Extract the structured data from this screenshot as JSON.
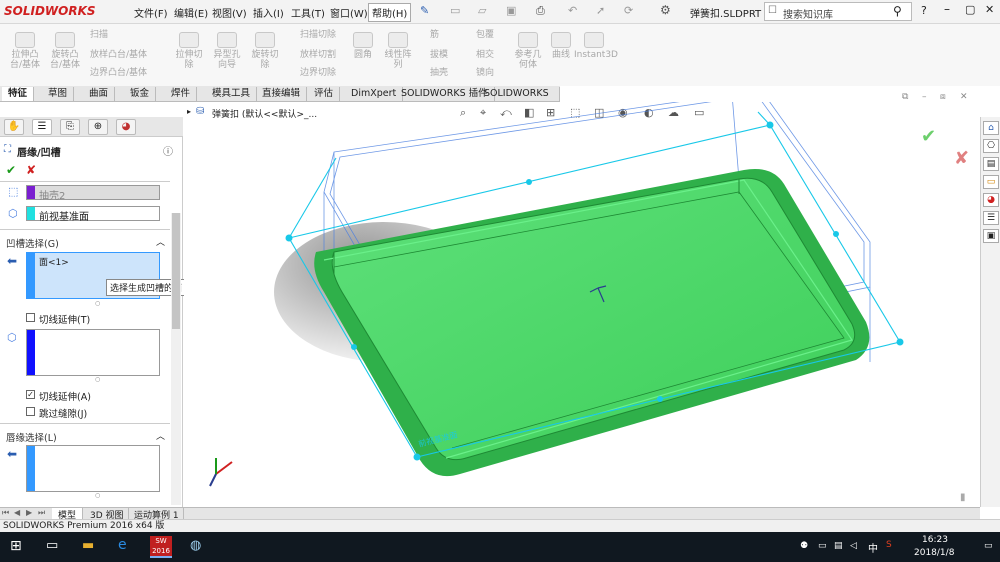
{
  "titlebar": {
    "logo": "SOLIDWORKS",
    "menus": [
      "文件(F)",
      "编辑(E)",
      "视图(V)",
      "插入(I)",
      "工具(T)",
      "窗口(W)",
      "帮助(H)"
    ],
    "document": "弹簧扣.SLDPRT *",
    "search_placeholder": "搜索知识库"
  },
  "ribbon": {
    "items": [
      {
        "label": "拉伸凸\n台/基体"
      },
      {
        "label": "旋转凸\n台/基体"
      },
      {
        "label": "扫描"
      },
      {
        "label": "放样凸台/基体"
      },
      {
        "label": "边界凸台/基体"
      },
      {
        "label": "拉伸切\n除"
      },
      {
        "label": "异型孔\n向导"
      },
      {
        "label": "旋转切\n除"
      },
      {
        "label": "扫描切除"
      },
      {
        "label": "放样切割"
      },
      {
        "label": "边界切除"
      },
      {
        "label": "圆角"
      },
      {
        "label": "线性阵\n列"
      },
      {
        "label": "筋"
      },
      {
        "label": "拔模"
      },
      {
        "label": "抽壳"
      },
      {
        "label": "包覆"
      },
      {
        "label": "相交"
      },
      {
        "label": "镜向"
      },
      {
        "label": "参考几\n何体"
      },
      {
        "label": "曲线"
      },
      {
        "label": "Instant3D"
      }
    ]
  },
  "command_tabs": [
    "特征",
    "草图",
    "曲面",
    "钣金",
    "焊件",
    "模具工具",
    "直接编辑",
    "评估",
    "DimXpert",
    "SOLIDWORKS 插件",
    "SOLIDWORKS MBD"
  ],
  "viewport": {
    "tree_title": "弹簧扣 (默认<<默认>_...",
    "annotation": "前视基准面"
  },
  "property_manager": {
    "title": "唇缘/凹槽",
    "body_field": "抽壳2",
    "plane_field": "前视基准面",
    "groove_section": "凹槽选择(G)",
    "groove_face": "面<1>",
    "tooltip": "选择生成凹槽的面",
    "tangent1": "切线延伸(T)",
    "tangent2": "切线延伸(A)",
    "skip_gaps": "跳过缝隙(J)",
    "lip_section": "唇缘选择(L)"
  },
  "bottom_tabs": [
    "模型",
    "3D 视图",
    "运动算例 1"
  ],
  "status": "SOLIDWORKS Premium 2016 x64 版",
  "taskbar": {
    "time": "16:23",
    "date": "2018/1/8",
    "ime": "中",
    "sw_year": "2016"
  },
  "colors": {
    "accent_red": "#d02020",
    "model_green": "#3ecf5a",
    "edge_cyan": "#18c8e8",
    "wire_blue": "#4a7fe0",
    "field_purple": "#7a1fd0",
    "field_cyan": "#20e0e0",
    "field_blue": "#1010ff"
  }
}
